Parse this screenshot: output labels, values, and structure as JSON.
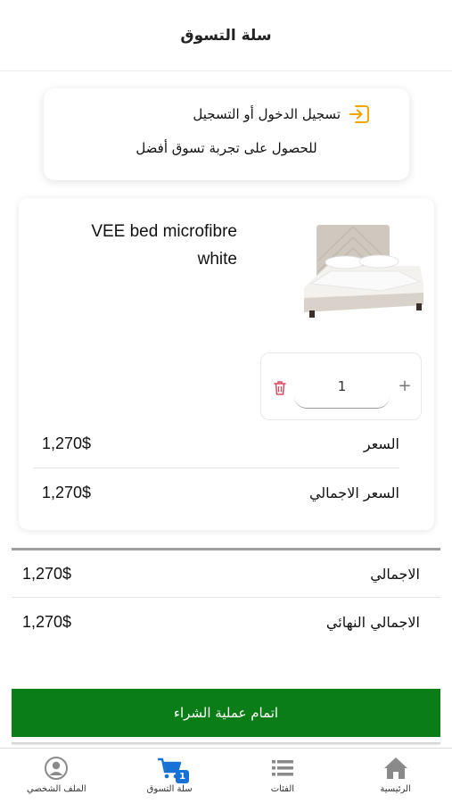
{
  "header": {
    "title": "سلة التسوق"
  },
  "login_prompt": {
    "title": "تسجيل الدخول أو التسجيل",
    "subtitle": "للحصول على تجربة تسوق أفضل",
    "icon": "login-arrow-icon",
    "icon_color": "#f0a500"
  },
  "cart_item": {
    "name_line1": "VEE bed microfibre",
    "name_line2": "white",
    "image": "bed-product-image",
    "quantity": "1",
    "plus_label": "+",
    "price_label": "السعر",
    "price_value": "1,270$",
    "total_label": "السعر الاجمالي",
    "total_value": "1,270$"
  },
  "summary": {
    "total_label": "الاجمالي",
    "total_value": "1,270$",
    "final_label": "الاجمالي النهائي",
    "final_value": "1,270$"
  },
  "checkout": {
    "label": "اتمام عملية الشراء",
    "color": "#0a7d16"
  },
  "tabbar": {
    "tabs": [
      {
        "label": "الملف الشخصي",
        "icon": "profile-icon"
      },
      {
        "label": "سلة التسوق",
        "icon": "cart-icon",
        "badge": "1",
        "active": true
      },
      {
        "label": "الفئات",
        "icon": "list-icon"
      },
      {
        "label": "الرئيسية",
        "icon": "home-icon"
      }
    ]
  }
}
